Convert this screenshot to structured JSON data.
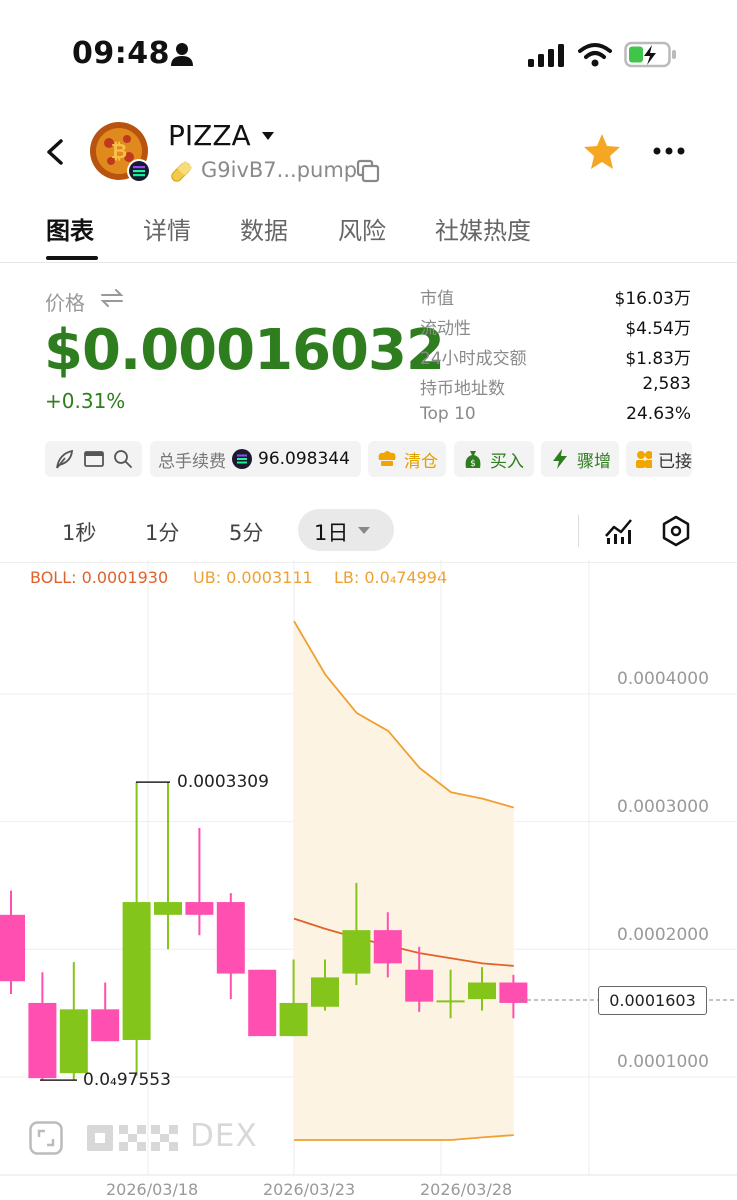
{
  "status_bar": {
    "time": "09:48"
  },
  "header": {
    "token_name": "PIZZA",
    "token_address": "G9ivB7...pump"
  },
  "tabs": [
    {
      "label": "图表",
      "active": true
    },
    {
      "label": "详情",
      "active": false
    },
    {
      "label": "数据",
      "active": false
    },
    {
      "label": "风险",
      "active": false
    },
    {
      "label": "社媒热度",
      "active": false
    }
  ],
  "price": {
    "label": "价格",
    "value": "$0.00016032",
    "change": "+0.31%",
    "change_color": "#2e7d1f"
  },
  "stats": [
    {
      "label": "市值",
      "value": "$16.03万"
    },
    {
      "label": "流动性",
      "value": "$4.54万"
    },
    {
      "label": "24小时成交额",
      "value": "$1.83万"
    },
    {
      "label": "持币地址数",
      "value": "2,583"
    },
    {
      "label": "Top 10",
      "value": "24.63%"
    }
  ],
  "chips": {
    "fee_label": "总手续费",
    "fee_value": "96.098344",
    "clear": "清仓",
    "buy": "买入",
    "surge": "骤增",
    "partial": "已接"
  },
  "intervals": [
    {
      "label": "1秒",
      "active": false
    },
    {
      "label": "1分",
      "active": false
    },
    {
      "label": "5分",
      "active": false
    },
    {
      "label": "1日",
      "active": true
    }
  ],
  "legend": {
    "boll": "BOLL: 0.0001930",
    "ub": "UB: 0.0003111",
    "lb": "LB: 0.0₄74994",
    "boll_color": "#e0622a",
    "band_color": "#f0a030"
  },
  "watermark": "DEX",
  "colors": {
    "up": "#84c51b",
    "down": "#ff4fb0",
    "accent_green": "#2e7d1f",
    "star": "#f5a623"
  },
  "chart_data": {
    "type": "candlestick",
    "y_tick_labels": [
      "0.0004000",
      "0.0003000",
      "0.0002000",
      "0.0001000"
    ],
    "y_ticks": [
      0.0004,
      0.0003,
      0.0002,
      0.0001
    ],
    "x_tick_labels": [
      "2026/03/18",
      "2026/03/23",
      "2026/03/28"
    ],
    "high_label": "0.0003309",
    "low_label": "0.0₄97553",
    "current_price_label": "0.0001603",
    "current_price": 0.0001603,
    "candles": [
      {
        "open": 0.000175,
        "close": 0.000227,
        "high": 0.000246,
        "low": 0.000165,
        "dir": "down"
      },
      {
        "open": 9.91e-05,
        "close": 0.000158,
        "high": 0.000182,
        "low": 9.76e-05,
        "dir": "down"
      },
      {
        "open": 0.000103,
        "close": 0.000153,
        "high": 0.00019,
        "low": 9.8e-05,
        "dir": "up"
      },
      {
        "open": 0.000128,
        "close": 0.000153,
        "high": 0.000174,
        "low": 0.000128,
        "dir": "down"
      },
      {
        "open": 0.000129,
        "close": 0.000237,
        "high": 0.000331,
        "low": 0.000101,
        "dir": "up"
      },
      {
        "open": 0.000227,
        "close": 0.000237,
        "high": 0.000331,
        "low": 0.0002,
        "dir": "up"
      },
      {
        "open": 0.000227,
        "close": 0.000237,
        "high": 0.000295,
        "low": 0.000211,
        "dir": "down"
      },
      {
        "open": 0.000181,
        "close": 0.000237,
        "high": 0.000244,
        "low": 0.000161,
        "dir": "down"
      },
      {
        "open": 0.000132,
        "close": 0.000184,
        "high": 0.000184,
        "low": 0.000132,
        "dir": "down"
      },
      {
        "open": 0.000132,
        "close": 0.000158,
        "high": 0.000192,
        "low": 0.000132,
        "dir": "up"
      },
      {
        "open": 0.000155,
        "close": 0.000178,
        "high": 0.000192,
        "low": 0.000152,
        "dir": "up"
      },
      {
        "open": 0.000181,
        "close": 0.000215,
        "high": 0.000252,
        "low": 0.000172,
        "dir": "up"
      },
      {
        "open": 0.000189,
        "close": 0.000215,
        "high": 0.000229,
        "low": 0.000178,
        "dir": "down"
      },
      {
        "open": 0.000159,
        "close": 0.000184,
        "high": 0.000202,
        "low": 0.000151,
        "dir": "down"
      },
      {
        "open": 0.000159,
        "close": 0.00016,
        "high": 0.000184,
        "low": 0.000146,
        "dir": "up"
      },
      {
        "open": 0.000161,
        "close": 0.000174,
        "high": 0.000186,
        "low": 0.000152,
        "dir": "up"
      },
      {
        "open": 0.000158,
        "close": 0.000174,
        "high": 0.00018,
        "low": 0.000146,
        "dir": "down"
      }
    ],
    "boll_mid": [
      0.000224,
      0.000216,
      0.000209,
      0.000203,
      0.000197,
      0.000193,
      0.000189,
      0.000187
    ],
    "boll_upper": [
      0.000457,
      0.000415,
      0.000385,
      0.000371,
      0.000342,
      0.000323,
      0.000318,
      0.000311
    ],
    "boll_lower": [
      0.0,
      2.86e-05,
      3.19e-05,
      3.83e-05,
      4.64e-05,
      5.05e-05,
      5.27e-05,
      5.45e-05
    ]
  }
}
